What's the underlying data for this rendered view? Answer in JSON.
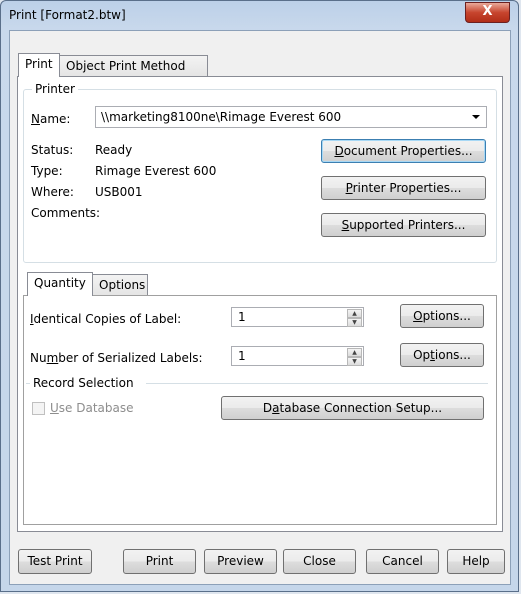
{
  "window": {
    "title": "Print [Format2.btw]",
    "close_glyph": "X"
  },
  "top_tabs": [
    {
      "label": "Print"
    },
    {
      "label": "Object Print Method"
    }
  ],
  "printer": {
    "group_title": "Printer",
    "name_label": "Name:",
    "name_value": "\\\\marketing8100ne\\Rimage Everest 600",
    "status_label": "Status:",
    "status_value": "Ready",
    "type_label": "Type:",
    "type_value": "Rimage Everest 600",
    "where_label": "Where:",
    "where_value": "USB001",
    "comments_label": "Comments:",
    "comments_value": "",
    "document_properties": "Document Properties...",
    "printer_properties": "Printer Properties...",
    "supported_printers": "Supported Printers..."
  },
  "inner_tabs": [
    {
      "label": "Quantity"
    },
    {
      "label": "Options"
    }
  ],
  "quantity": {
    "identical_label": "Identical Copies of Label:",
    "identical_value": "1",
    "serialized_label": "Number of Serialized Labels:",
    "serialized_value": "1",
    "options_label": "Options..."
  },
  "record_selection": {
    "title": "Record Selection",
    "use_database_label": "Use Database",
    "use_database_checked": false,
    "db_setup_label": "Database Connection Setup..."
  },
  "footer": {
    "test_print": "Test Print",
    "print": "Print",
    "preview": "Preview",
    "close": "Close",
    "cancel": "Cancel",
    "help": "Help"
  }
}
